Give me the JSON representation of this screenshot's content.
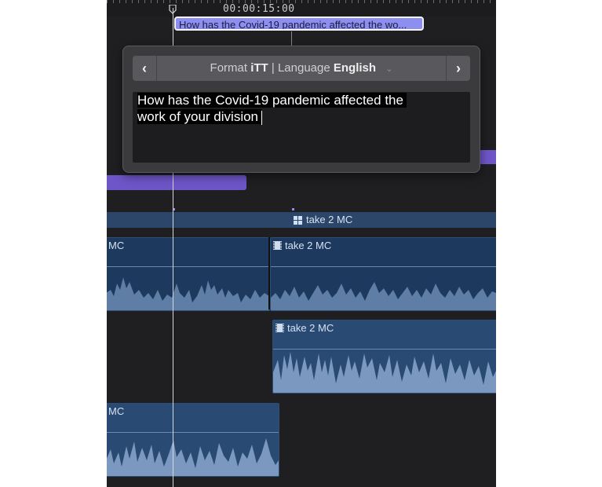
{
  "ruler": {
    "timecode": "00:00:15:00"
  },
  "caption_chip": {
    "text": "How has the Covid-19 pandemic affected the wo..."
  },
  "caption_editor": {
    "format_label": "Format",
    "format_value": "iTT",
    "separator": "|",
    "language_label": "Language",
    "language_value": "English",
    "prev_icon": "chevron-left-icon",
    "next_icon": "chevron-right-icon",
    "text_line1": "How has the Covid-19 pandemic affected the",
    "text_line2": "work of your division"
  },
  "storyline": {
    "label": "take 2 MC",
    "icon": "multicam-grid-icon"
  },
  "clips": [
    {
      "label": "MC"
    },
    {
      "label": "take 2 MC",
      "icon": "film-icon"
    },
    {
      "label": "take 2 MC",
      "icon": "film-icon"
    },
    {
      "label": "MC"
    }
  ],
  "colors": {
    "timeline_bg": "#1f1f21",
    "caption_purple": "#6e55c8",
    "clip_blue": "#1d3a5e",
    "waveform": "#5f7ea6",
    "chip": "#8d8ff0"
  }
}
